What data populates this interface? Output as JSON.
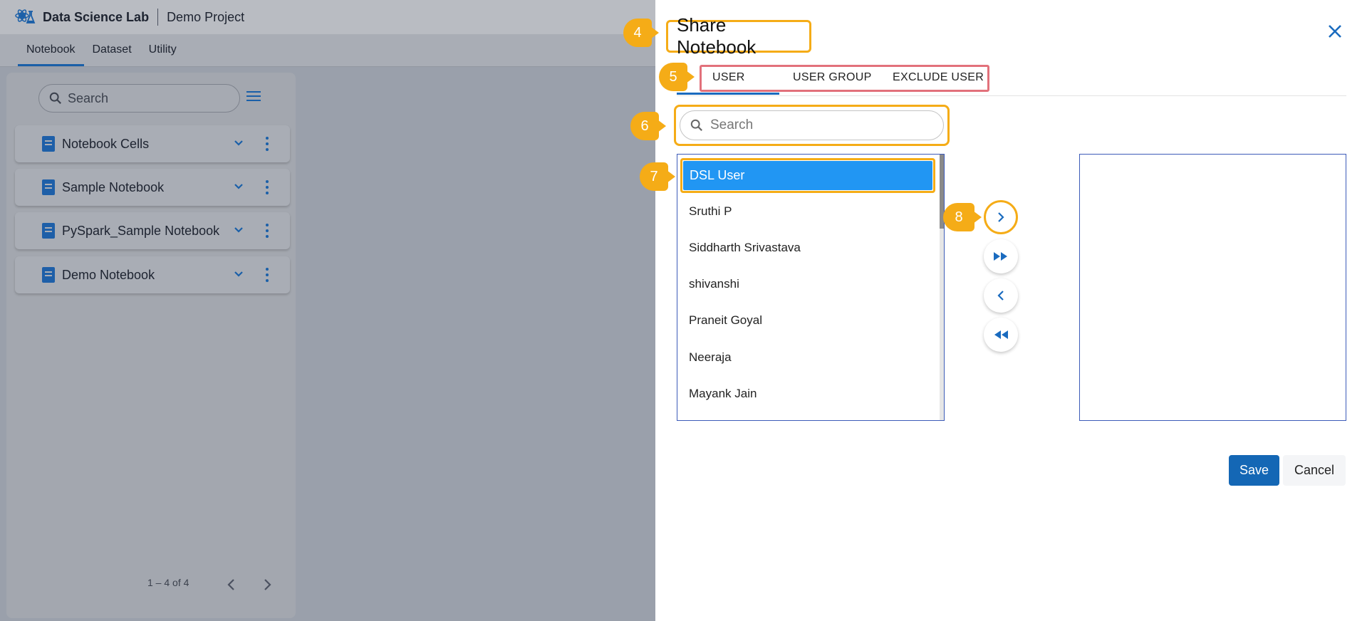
{
  "app": {
    "title": "Data Science Lab",
    "project": "Demo Project",
    "tabs": [
      "Notebook",
      "Dataset",
      "Utility"
    ],
    "active_tab": "Notebook"
  },
  "sidebar": {
    "search_placeholder": "Search",
    "notebooks": [
      {
        "label": "Notebook Cells"
      },
      {
        "label": "Sample Notebook"
      },
      {
        "label": "PySpark_Sample Notebook"
      },
      {
        "label": "Demo Notebook"
      }
    ],
    "pagination": "1 – 4 of 4"
  },
  "dialog": {
    "title": "Share Notebook",
    "tabs": [
      "USER",
      "USER GROUP",
      "EXCLUDE USER"
    ],
    "active_tab": "USER",
    "search_placeholder": "Search",
    "users": [
      "DSL User",
      "Sruthi P",
      "Siddharth Srivastava",
      "shivanshi",
      "Praneit Goyal",
      "Neeraja",
      "Mayank Jain"
    ],
    "selected_user": "DSL User",
    "save_label": "Save",
    "cancel_label": "Cancel"
  },
  "markers": [
    "4",
    "5",
    "6",
    "7",
    "8"
  ],
  "colors": {
    "accent": "#1a6bbf",
    "selection": "#2196f3",
    "highlight": "#f5ac17",
    "tabs_highlight": "#e2717b",
    "overlay": "#9aa0ab"
  }
}
